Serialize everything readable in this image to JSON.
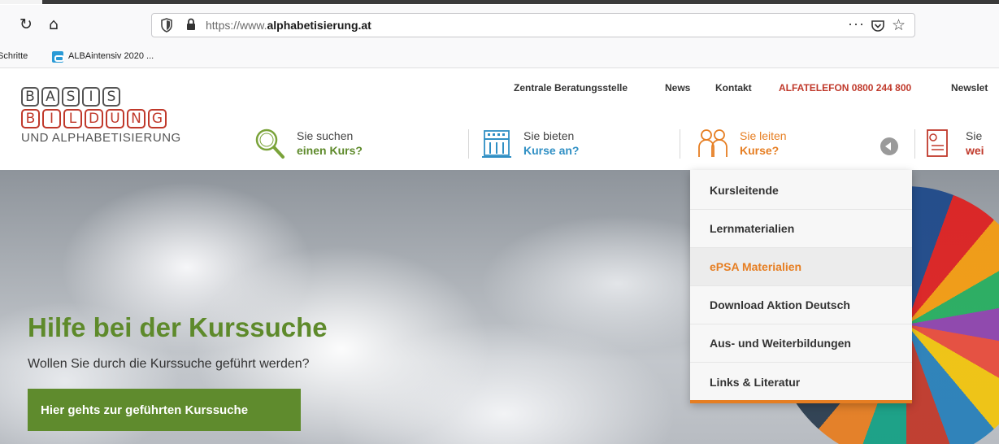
{
  "browser": {
    "url_prefix": "https://www.",
    "url_domain": "alphabetisierung.at",
    "url_more": "···",
    "bookmarks": [
      "Schritte",
      "ALBAintensiv 2020 ..."
    ]
  },
  "logo": {
    "row1": [
      "B",
      "A",
      "S",
      "I",
      "S"
    ],
    "row2": [
      "B",
      "I",
      "L",
      "D",
      "U",
      "N",
      "G"
    ],
    "caption": "UND ALPHABETISIERUNG"
  },
  "topnav": {
    "items": [
      "Zentrale Beratungsstelle",
      "News",
      "Kontakt",
      "ALFATELEFON 0800 244 800",
      "Newslet"
    ]
  },
  "services": [
    {
      "line1": "Sie suchen",
      "line2": "einen Kurs?",
      "color": "#5e8a2b"
    },
    {
      "line1": "Sie bieten",
      "line2": "Kurse an?",
      "color": "#2f8fc4"
    },
    {
      "line1": "Sie leiten",
      "line2": "Kurse?",
      "color": "#e67e22"
    },
    {
      "line1": "Sie ",
      "line2": "wei",
      "color": "#c0392b"
    }
  ],
  "hero": {
    "title": "Hilfe bei der Kurssuche",
    "subtitle": "Wollen Sie durch die Kurssuche geführt werden?",
    "button": "Hier gehts zur geführten Kurssuche"
  },
  "dropdown": {
    "items": [
      "Kursleitende",
      "Lernmaterialien",
      "ePSA Materialien",
      "Download Aktion Deutsch",
      "Aus- und Weiterbildungen",
      "Links & Literatur"
    ],
    "active_index": 2
  },
  "colors": {
    "green": "#5f8b2d",
    "orange": "#e67e22",
    "red": "#c0392b",
    "blue": "#2f8fc4"
  }
}
